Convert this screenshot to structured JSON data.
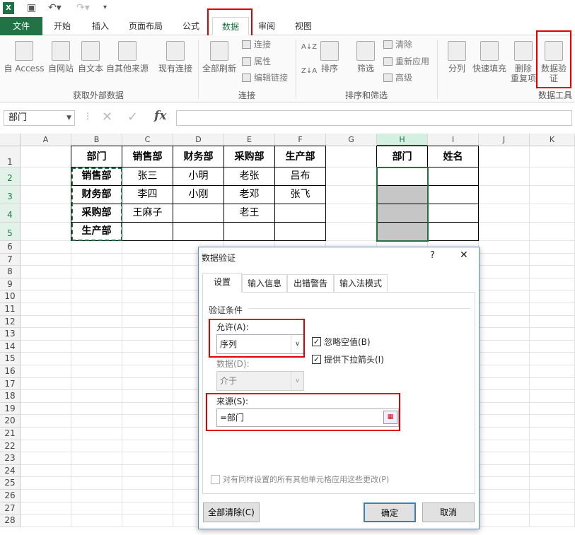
{
  "app": {
    "logo": "X"
  },
  "tabs": [
    "文件",
    "开始",
    "插入",
    "页面布局",
    "公式",
    "数据",
    "审阅",
    "视图"
  ],
  "ribbon": {
    "external": [
      "自 Access",
      "自网站",
      "自文本",
      "自其他来源",
      "现有连接"
    ],
    "external_label": "获取外部数据",
    "refresh": "全部刷新",
    "conn_items": [
      "连接",
      "属性",
      "编辑链接"
    ],
    "conn_label": "连接",
    "sort": "排序",
    "filter": "筛选",
    "filter_items": [
      "清除",
      "重新应用",
      "高级"
    ],
    "sort_label": "排序和筛选",
    "split": "分列",
    "flash": "快速填充",
    "dedup": "删除\n重复项",
    "validation": "数据验\n证",
    "tools_label": "数据工具"
  },
  "formula": {
    "name_box": "部门",
    "fx": "fx",
    "content": ""
  },
  "columns": [
    "A",
    "B",
    "C",
    "D",
    "E",
    "F",
    "G",
    "H",
    "I",
    "J",
    "K"
  ],
  "rows": [
    "1",
    "2",
    "3",
    "4",
    "5",
    "6",
    "7",
    "8",
    "9",
    "10",
    "11",
    "12",
    "13",
    "14",
    "15",
    "16",
    "17",
    "18",
    "19",
    "20",
    "21",
    "22",
    "23",
    "24",
    "25",
    "26",
    "27",
    "28"
  ],
  "table1": {
    "header": [
      "部门",
      "销售部",
      "财务部",
      "采购部",
      "生产部"
    ],
    "rows": [
      [
        "销售部",
        "张三",
        "小明",
        "老张",
        "吕布"
      ],
      [
        "财务部",
        "李四",
        "小刚",
        "老邓",
        "张飞"
      ],
      [
        "采购部",
        "王麻子",
        "",
        "老王",
        ""
      ],
      [
        "生产部",
        "",
        "",
        "",
        ""
      ]
    ]
  },
  "table2": {
    "header": [
      "部门",
      "姓名"
    ]
  },
  "dialog": {
    "title": "数据验证",
    "help": "?",
    "close": "✕",
    "tabs": [
      "设置",
      "输入信息",
      "出错警告",
      "输入法模式"
    ],
    "section": "验证条件",
    "allow_label": "允许(A):",
    "allow_value": "序列",
    "ignore_blank": "忽略空值(B)",
    "dropdown": "提供下拉箭头(I)",
    "data_label": "数据(D):",
    "data_value": "介于",
    "source_label": "来源(S):",
    "source_value": "=部门",
    "apply_all": "对有同样设置的所有其他单元格应用这些更改(P)",
    "clear_all": "全部清除(C)",
    "ok": "确定",
    "cancel": "取消"
  }
}
